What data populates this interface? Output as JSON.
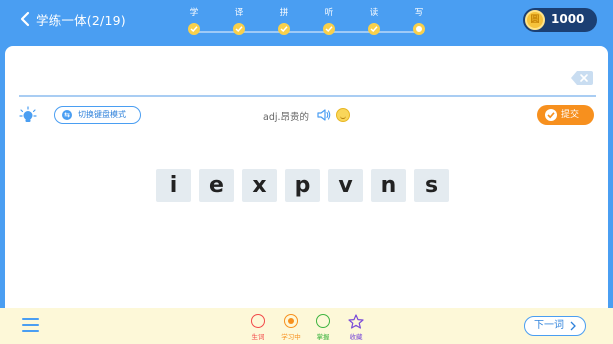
{
  "header": {
    "title": "学练一体(2/19)",
    "steps": [
      "学",
      "译",
      "拼",
      "听",
      "读",
      "写"
    ],
    "current_step": "写",
    "coin_label": "圆",
    "coins": "1000"
  },
  "toolbar": {
    "keyboard_switch_label": "切换键盘模式",
    "meaning": "adj.昂贵的",
    "submit_label": "提交"
  },
  "letters": [
    "i",
    "e",
    "x",
    "p",
    "v",
    "n",
    "s"
  ],
  "footer": {
    "statuses": [
      {
        "label": "生词",
        "color": "#f24a4a"
      },
      {
        "label": "学习中",
        "color": "#f7901e"
      },
      {
        "label": "掌握",
        "color": "#3fb441"
      },
      {
        "label": "收藏",
        "color": "#7a4ad8"
      }
    ],
    "next_label": "下一词"
  },
  "colors": {
    "primary": "#4a9ef2",
    "accent": "#f7901e",
    "step_done": "#f9d04b"
  }
}
